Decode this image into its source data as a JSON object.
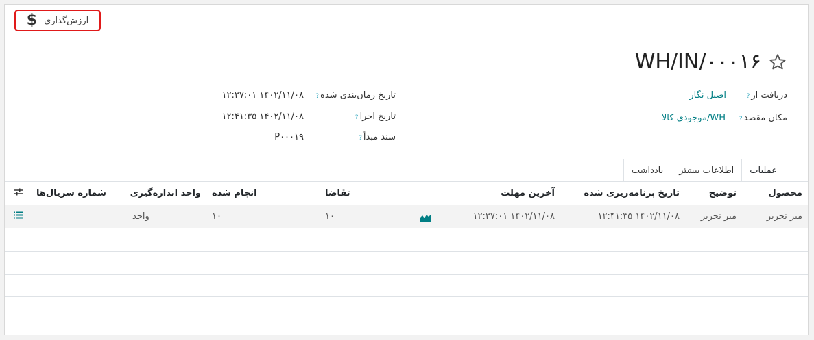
{
  "smart_button": {
    "icon": "dollar-icon",
    "label": "ارزش‌گذاری"
  },
  "record": {
    "title": "WH/IN/۰۰۰۱۶"
  },
  "fields": {
    "receive_from": {
      "label": "دریافت از",
      "value": "اصیل نگار"
    },
    "destination": {
      "label": "مکان مقصد",
      "value": "WH/موجودی کالا"
    },
    "scheduled_date": {
      "label": "تاریخ زمان‌بندی شده",
      "value": "۱۴۰۲/۱۱/۰۸ ۱۲:۳۷:۰۱"
    },
    "effective_date": {
      "label": "تاریخ اجرا",
      "value": "۱۴۰۲/۱۱/۰۸ ۱۲:۴۱:۳۵"
    },
    "source_document": {
      "label": "سند مبدأ",
      "value": "P۰۰۰۱۹"
    },
    "help_mark": "?"
  },
  "tabs": [
    {
      "label": "عملیات",
      "active": true
    },
    {
      "label": "اطلاعات بیشتر",
      "active": false
    },
    {
      "label": "یادداشت",
      "active": false
    }
  ],
  "table": {
    "headers": {
      "product": "محصول",
      "description": "توضیح",
      "date_scheduled": "تاریخ برنامه‌ریزی شده",
      "deadline": "آخرین مهلت",
      "demand": "تقاضا",
      "quantity": "انجام شده",
      "uom": "واحد اندازه‌گیری",
      "serials": "شماره سریال‌ها"
    },
    "rows": [
      {
        "product": "میز تحریر",
        "description": "میز تحریر",
        "date_scheduled": "۱۴۰۲/۱۱/۰۸ ۱۲:۴۱:۳۵",
        "deadline": "۱۴۰۲/۱۱/۰۸ ۱۲:۳۷:۰۱",
        "demand": "۱۰",
        "quantity": "۱۰",
        "uom": "واحد"
      }
    ]
  },
  "colors": {
    "accent": "#017e84",
    "highlight_border": "#e01a1a",
    "help": "#2da6bd"
  }
}
